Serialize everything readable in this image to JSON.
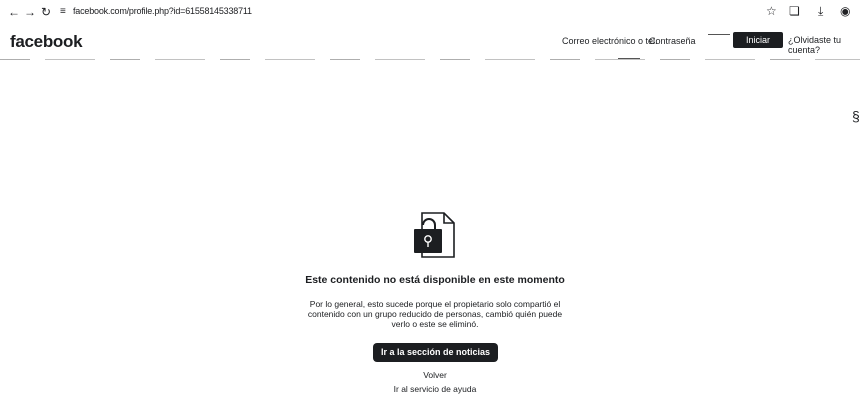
{
  "browser": {
    "url": "facebook.com/profile.php?id=61558145338711"
  },
  "header": {
    "logo": "facebook",
    "email_label": "Correo electrónico o tel.",
    "password_label": "Contraseña",
    "login_button": "Iniciar sesión",
    "forgot_link": "¿Olvidaste tu cuenta?"
  },
  "main": {
    "title": "Este contenido no está disponible en este momento",
    "description": "Por lo general, esto sucede porque el propietario solo compartió el contenido con un grupo reducido de personas, cambió quién puede verlo o este se eliminó.",
    "news_button": "Ir a la sección de noticias",
    "back_link": "Volver",
    "help_link": "Ir al servicio de ayuda"
  },
  "icons": [
    "back-icon",
    "forward-icon",
    "reload-icon",
    "site-info-icon",
    "star-icon",
    "extensions-icon",
    "download-icon",
    "account-icon",
    "locked-content-icon"
  ]
}
